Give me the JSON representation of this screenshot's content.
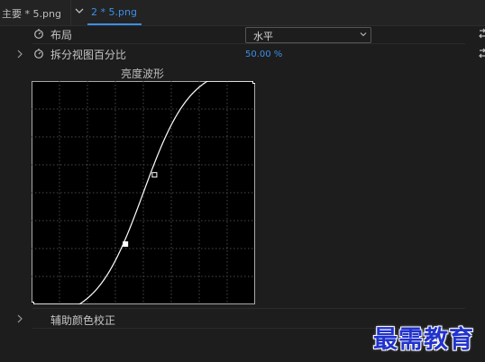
{
  "tabs": {
    "main_label": "主要 * 5.png",
    "active_label": "2 * 5.png"
  },
  "layout_row": {
    "label": "布局",
    "value": "水平"
  },
  "split_row": {
    "label": "拆分视图百分比",
    "value": "50.00 %"
  },
  "curve_panel": {
    "title": "亮度波形",
    "grid_divisions": 8,
    "line_color": "#ffffff",
    "curve_type": "s-curve",
    "control_points": [
      {
        "in": 0.0,
        "out": 0.0
      },
      {
        "in": 0.42,
        "out": 0.27
      },
      {
        "in": 0.55,
        "out": 0.58
      },
      {
        "in": 1.0,
        "out": 1.0
      }
    ]
  },
  "assist_row": {
    "label": "辅助颜色校正"
  },
  "watermark": {
    "text": "最需教育"
  },
  "icons": [
    "chevron-down-icon",
    "stopwatch-icon",
    "chevron-right-icon",
    "reset-icon",
    "caret-down-icon"
  ],
  "colors": {
    "accent": "#3b8fe6",
    "background": "#1d1d1d",
    "watermark": "#2233cc"
  }
}
